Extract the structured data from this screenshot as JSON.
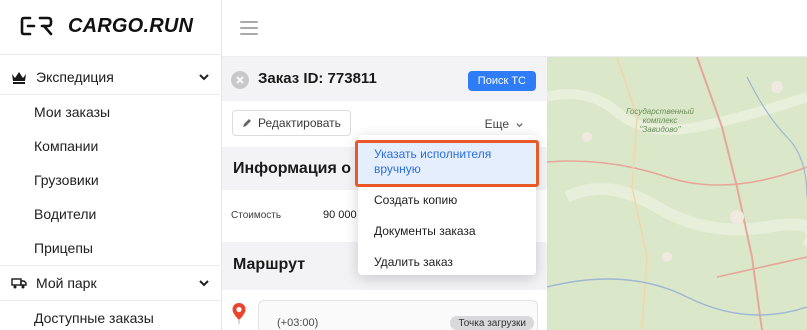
{
  "logo": {
    "text": "CARGO.RUN"
  },
  "sidebar": {
    "groups": [
      {
        "label": "Экспедиция",
        "icon": "crown-icon",
        "items": [
          "Мои заказы",
          "Компании",
          "Грузовики",
          "Водители",
          "Прицепы"
        ]
      },
      {
        "label": "Мой парк",
        "icon": "truck-icon",
        "items": [
          "Доступные заказы"
        ]
      }
    ]
  },
  "order": {
    "title": "Заказ ID: 773811",
    "search_button": "Поиск ТС",
    "edit_button": "Редактировать",
    "more_button": "Еще",
    "info_title": "Информация о заказе",
    "cost_label": "Стоимость",
    "cost_value": "90 000",
    "route_title": "Маршрут",
    "stop_time": "(+03:00)",
    "stop_badge": "Точка загрузки"
  },
  "dropdown": {
    "items": [
      "Указать исполнителя вручную",
      "Создать копию",
      "Документы заказа",
      "Удалить заказ"
    ]
  },
  "map": {
    "label": "Государственный комплекс \"Завидово\""
  },
  "colors": {
    "accent": "#2e7cf6",
    "focus_outline": "#e8592a",
    "highlight_bg": "#e4eefc",
    "panel_bg": "#f3f3f5",
    "map_green": "#d8e6c7"
  }
}
